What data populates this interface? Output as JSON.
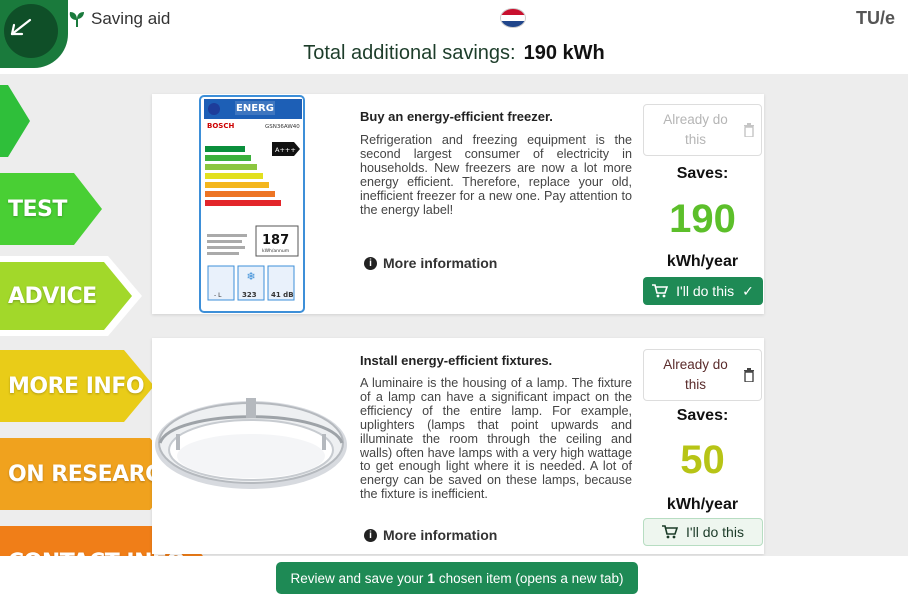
{
  "header": {
    "brand": "Saving aid",
    "logo_right": "TU/e",
    "total_label": "Total additional savings:",
    "total_value": "190 kWh",
    "flag_colors": [
      "#c8102e",
      "#ffffff",
      "#21468b"
    ]
  },
  "nav": {
    "items": [
      {
        "label": "",
        "color": "#2fbf3a"
      },
      {
        "label": "TEST",
        "color": "#49cf34"
      },
      {
        "label": "ADVICE",
        "color": "#a2d82a"
      },
      {
        "label": "MORE INFO",
        "color": "#e9cc18"
      },
      {
        "label": "ON RESEARCH",
        "color": "#f0a21e"
      },
      {
        "label": "CONTACT INFO",
        "color": "#f07e18"
      }
    ]
  },
  "cards": [
    {
      "title": "Buy an energy-efficient freezer.",
      "description": "Refrigeration and freezing equipment is the second largest consumer of electricity in households. New freezers are now a lot more energy efficient. Therefore, replace your old, inefficient freezer for a new one. Pay attention to the energy label!",
      "more_info": "More information",
      "already": "Already do this",
      "saves_label": "Saves:",
      "saves_value": "190",
      "saves_unit": "kWh/year",
      "saves_color": "#5cbf2a",
      "button": "I'll do this",
      "button_check": "✓",
      "image": {
        "label_top": "ENERG",
        "brand": "BOSCH",
        "model": "GSN36AW40",
        "class": "A+++",
        "consumption": "187",
        "consumption_unit": "kWh/annum",
        "icon1": "- L",
        "icon2": "323",
        "icon3": "41 dB"
      }
    },
    {
      "title": "Install energy-efficient fixtures.",
      "description": "A luminaire is the housing of a lamp. The fixture of a lamp can have a significant impact on the efficiency of the entire lamp. For example, uplighters (lamps that point upwards and illuminate the room through the ceiling and walls) often have lamps with a very high wattage to get enough light where it is needed. A lot of energy can be saved on these lamps, because the fixture is inefficient.",
      "more_info": "More information",
      "already": "Already do this",
      "saves_label": "Saves:",
      "saves_value": "50",
      "saves_unit": "kWh/year",
      "saves_color": "#b7c416",
      "button": "I'll do this"
    }
  ],
  "footer": {
    "review_prefix": "Review and save your",
    "review_count": "1",
    "review_suffix": "chosen item  (opens a new tab)"
  }
}
